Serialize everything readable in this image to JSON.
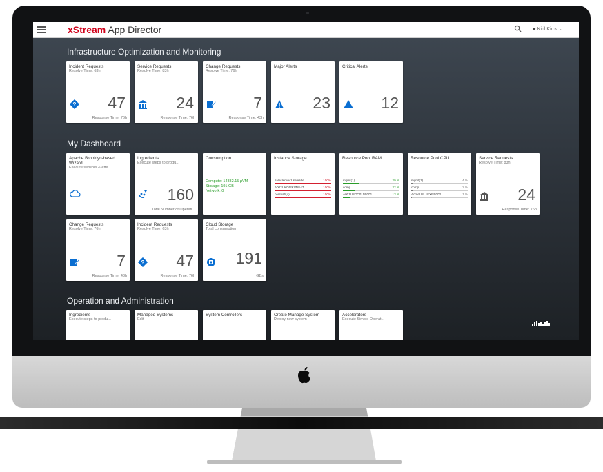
{
  "app": {
    "brand": "xStream",
    "name": " App Director"
  },
  "user": {
    "name": "Kiril Kirov"
  },
  "sections": {
    "infra": "Infrastructure Optimization and Monitoring",
    "dash": "My Dashboard",
    "ops": "Operation and Administration"
  },
  "infra_tiles": [
    {
      "title": "Incident Requests",
      "sub": "Resolve Time: 63h",
      "value": "47",
      "foot": "Response Time: 76h"
    },
    {
      "title": "Service Requests",
      "sub": "Resolve Time: 83h",
      "value": "24",
      "foot": "Response Time: 76h"
    },
    {
      "title": "Change Requests",
      "sub": "Resolve Time: 76h",
      "value": "7",
      "foot": "Response Time: 43h"
    },
    {
      "title": "Major Alerts",
      "value": "23"
    },
    {
      "title": "Critical Alerts",
      "value": "12"
    }
  ],
  "dash_tiles": {
    "apache": {
      "title": "Apache Brooklyn-based Wizard",
      "sub": "Execute sensors & effe..."
    },
    "ingredients": {
      "title": "Ingredients",
      "sub": "Execute steps to produ...",
      "value": "160",
      "foot": "Total Number of Operati..."
    },
    "consumption": {
      "title": "Consumption",
      "compute": "Compute: 14882.15 μVM",
      "storage": "Storage: 191 GB",
      "network": "Network: 0"
    },
    "instance_storage": {
      "title": "Instance Storage",
      "rows": [
        {
          "name": "saleslemov1.salesde",
          "pct": "100%",
          "level": 1.0
        },
        {
          "name": "A002UK042KVM147",
          "pct": "100%",
          "level": 1.0
        },
        {
          "name": "centos6(4)",
          "pct": "100%",
          "level": 1.0
        }
      ]
    },
    "resource_ram": {
      "title": "Resource Pool RAM",
      "rows": [
        {
          "name": "mgmt(1)",
          "pct": "29 %",
          "level": 0.29
        },
        {
          "name": "comp",
          "pct": "22 %",
          "level": 0.22
        },
        {
          "name": "A001USDC015P001",
          "pct": "13 %",
          "level": 0.13
        }
      ]
    },
    "resource_cpu": {
      "title": "Resource Pool CPU",
      "rows": [
        {
          "name": "mgmt(1)",
          "pct": "4 %",
          "level": 0.04
        },
        {
          "name": "comp",
          "pct": "2 %",
          "level": 0.02
        },
        {
          "name": "AcmeUSL1FXRP002",
          "pct": "1 %",
          "level": 0.01
        }
      ]
    },
    "service": {
      "title": "Service Requests",
      "sub": "Resolve Time: 83h",
      "value": "24",
      "foot": "Response Time: 76h"
    },
    "change": {
      "title": "Change Requests",
      "sub": "Resolve Time: 76h",
      "value": "7",
      "foot": "Response Time: 43h"
    },
    "incident": {
      "title": "Incident Requests",
      "sub": "Resolve Time: 63h",
      "value": "47",
      "foot": "Response Time: 76h"
    },
    "cloud": {
      "title": "Cloud Storage",
      "sub": "Total consumption",
      "value": "191",
      "foot": "GBs"
    }
  },
  "ops_tiles": [
    {
      "title": "Ingredients",
      "sub": "Execute steps to produ..."
    },
    {
      "title": "Managed Systems",
      "sub": "Edit"
    },
    {
      "title": "System Controllers",
      "sub": ""
    },
    {
      "title": "Create Manage System",
      "sub": "Deploy new system"
    },
    {
      "title": "Accelerators",
      "sub": "Execute Simple Operat..."
    }
  ],
  "colors": {
    "accent_blue": "#0a6ed1",
    "brand_red": "#d0021b",
    "danger": "#d32030",
    "success": "#2b7d2b"
  }
}
